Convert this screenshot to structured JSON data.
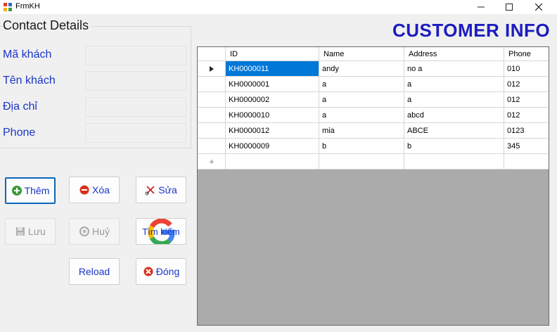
{
  "window": {
    "title": "FrmKH"
  },
  "form": {
    "group_title": "Contact Details",
    "fields": [
      {
        "label": "Mã khách",
        "value": ""
      },
      {
        "label": "Tên khách",
        "value": ""
      },
      {
        "label": "Địa chỉ",
        "value": ""
      },
      {
        "label": "Phone",
        "value": ""
      }
    ]
  },
  "buttons": {
    "add": "Thêm",
    "delete": "Xóa",
    "edit": "Sửa",
    "save": "Lưu",
    "cancel": "Huỷ",
    "search": "Tìm kiếm",
    "reload": "Reload",
    "close": "Đóng"
  },
  "header": {
    "title": "CUSTOMER INFO"
  },
  "grid": {
    "columns": [
      "ID",
      "Name",
      "Address",
      "Phone"
    ],
    "rows": [
      {
        "id": "KH0000011",
        "name": "andy",
        "address": "no a",
        "phone": "010"
      },
      {
        "id": "KH0000001",
        "name": "a",
        "address": "a",
        "phone": "012"
      },
      {
        "id": "KH0000002",
        "name": "a",
        "address": "a",
        "phone": "012"
      },
      {
        "id": "KH0000010",
        "name": "a",
        "address": "abcd",
        "phone": "012"
      },
      {
        "id": "KH0000012",
        "name": "mia",
        "address": "ABCE",
        "phone": "0123"
      },
      {
        "id": "KH0000009",
        "name": "b",
        "address": "b",
        "phone": "345"
      }
    ]
  },
  "colors": {
    "label_blue": "#1a36c8",
    "title_blue": "#1c1cc0",
    "selection": "#0078d7",
    "grid_empty": "#ababab"
  },
  "icons": {
    "add": "green-plus-icon",
    "delete": "red-minus-icon",
    "edit": "scissors-icon",
    "save": "floppy-disk-icon",
    "cancel": "refresh-icon",
    "search": "google-logo-icon",
    "close": "red-x-icon"
  }
}
